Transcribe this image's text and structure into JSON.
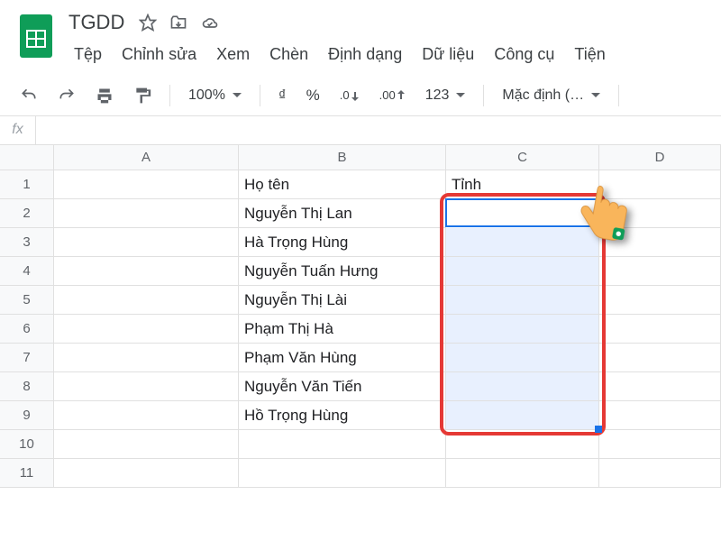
{
  "app": {
    "title": "TGDD"
  },
  "menubar": [
    "Tệp",
    "Chỉnh sửa",
    "Xem",
    "Chèn",
    "Định dạng",
    "Dữ liệu",
    "Công cụ",
    "Tiện"
  ],
  "toolbar": {
    "zoom": "100%",
    "currency": "₫",
    "percent": "%",
    "dec_dec": ".0",
    "inc_dec": ".00",
    "numfmt": "123",
    "font": "Mặc định (…"
  },
  "formula": {
    "fx": "fx",
    "value": ""
  },
  "columns": [
    "A",
    "B",
    "C",
    "D"
  ],
  "rows": [
    {
      "n": "1",
      "A": "",
      "B": "Họ tên",
      "C": "Tỉnh",
      "D": ""
    },
    {
      "n": "2",
      "A": "",
      "B": "Nguyễn Thị Lan",
      "C": "",
      "D": ""
    },
    {
      "n": "3",
      "A": "",
      "B": "Hà Trọng Hùng",
      "C": "",
      "D": ""
    },
    {
      "n": "4",
      "A": "",
      "B": "Nguyễn Tuấn Hưng",
      "C": "",
      "D": ""
    },
    {
      "n": "5",
      "A": "",
      "B": "Nguyễn Thị Lài",
      "C": "",
      "D": ""
    },
    {
      "n": "6",
      "A": "",
      "B": "Phạm Thị Hà",
      "C": "",
      "D": ""
    },
    {
      "n": "7",
      "A": "",
      "B": "Phạm Văn Hùng",
      "C": "",
      "D": ""
    },
    {
      "n": "8",
      "A": "",
      "B": "Nguyễn Văn Tiến",
      "C": "",
      "D": ""
    },
    {
      "n": "9",
      "A": "",
      "B": "Hồ Trọng Hùng",
      "C": "",
      "D": ""
    },
    {
      "n": "10",
      "A": "",
      "B": "",
      "C": "",
      "D": ""
    },
    {
      "n": "11",
      "A": "",
      "B": "",
      "C": "",
      "D": ""
    }
  ],
  "selection": {
    "col": "C",
    "rowStart": 2,
    "rowEnd": 9,
    "active": "C2"
  }
}
